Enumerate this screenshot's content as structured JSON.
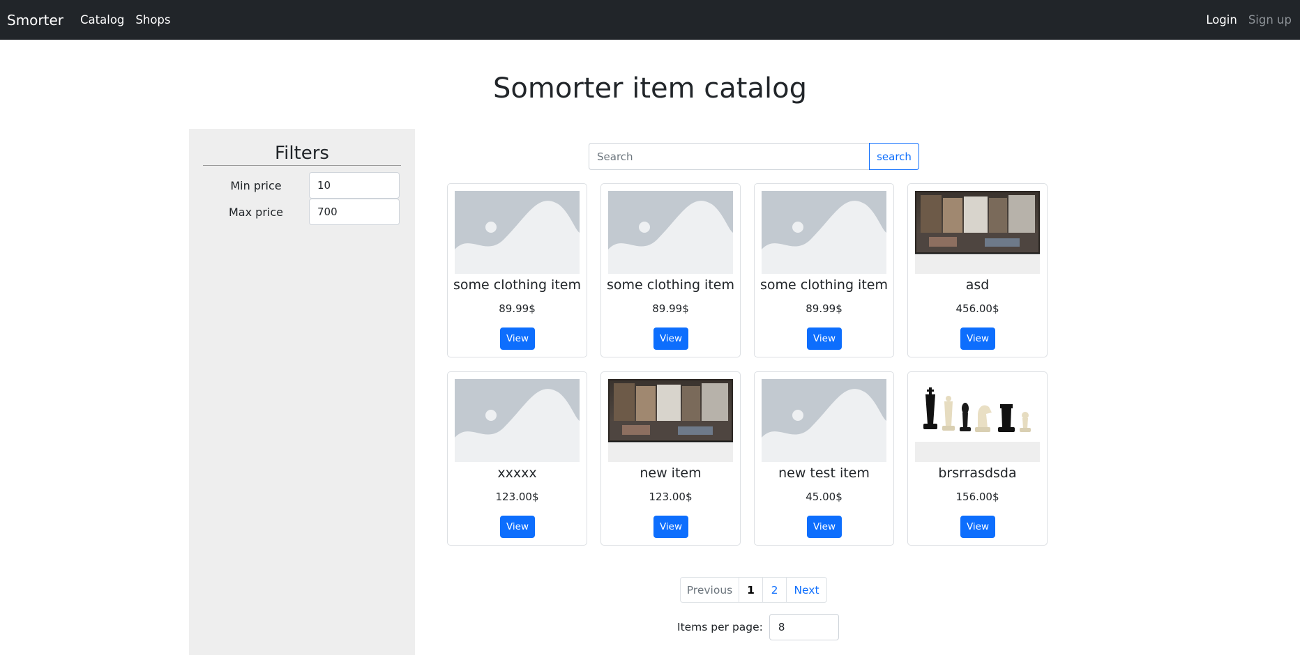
{
  "navbar": {
    "brand": "Smorter",
    "links": [
      "Catalog",
      "Shops"
    ],
    "login": "Login",
    "signup": "Sign up"
  },
  "page_title": "Somorter item catalog",
  "filters": {
    "title": "Filters",
    "min_price_label": "Min price",
    "min_price_value": "10",
    "max_price_label": "Max price",
    "max_price_value": "700"
  },
  "search": {
    "placeholder": "Search",
    "button": "search"
  },
  "items": [
    {
      "name": "some clothing item",
      "price": "89.99$",
      "button": "View",
      "image": "placeholder"
    },
    {
      "name": "some clothing item",
      "price": "89.99$",
      "button": "View",
      "image": "placeholder"
    },
    {
      "name": "some clothing item",
      "price": "89.99$",
      "button": "View",
      "image": "placeholder"
    },
    {
      "name": "asd",
      "price": "456.00$",
      "button": "View",
      "image": "panorama-room"
    },
    {
      "name": "xxxxx",
      "price": "123.00$",
      "button": "View",
      "image": "placeholder"
    },
    {
      "name": "new item",
      "price": "123.00$",
      "button": "View",
      "image": "panorama-room"
    },
    {
      "name": "new test item",
      "price": "45.00$",
      "button": "View",
      "image": "placeholder"
    },
    {
      "name": "brsrrasdsda",
      "price": "156.00$",
      "button": "View",
      "image": "chess-pieces"
    }
  ],
  "pagination": {
    "previous": "Previous",
    "pages": [
      "1",
      "2"
    ],
    "current_page": "1",
    "next": "Next"
  },
  "items_per_page": {
    "label": "Items per page:",
    "value": "8"
  }
}
